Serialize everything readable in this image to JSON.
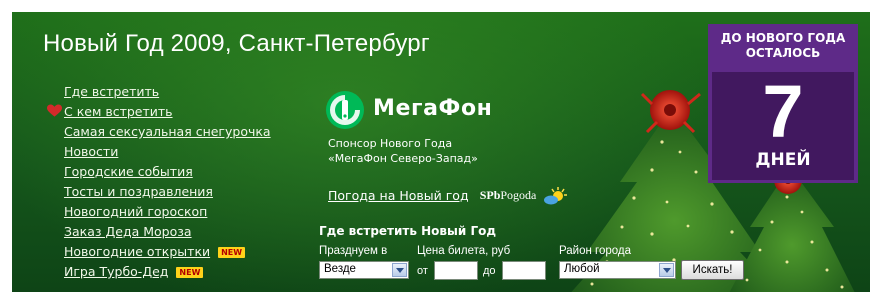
{
  "header": {
    "title": "Новый Год 2009, Санкт-Петербург"
  },
  "nav": {
    "items": [
      {
        "label": "Где встретить"
      },
      {
        "label": "С кем встретить",
        "icon": "heart-icon"
      },
      {
        "label": "Самая сексуальная снегурочка"
      },
      {
        "label": "Новости"
      },
      {
        "label": "Городские события"
      },
      {
        "label": "Тосты и поздравления"
      },
      {
        "label": "Новогодний гороскоп"
      },
      {
        "label": "Заказ Деда Мороза"
      },
      {
        "label": "Новогодние открытки",
        "badge": "NEW"
      },
      {
        "label": "Игра Турбо-Дед",
        "badge": "NEW"
      }
    ]
  },
  "sponsor": {
    "logo_text": "МегаФон",
    "line1": "Спонсор Нового Года",
    "line2": "«МегаФон Северо-Запад»"
  },
  "weather": {
    "link": "Погода на Новый год",
    "logo_bold": "SPb",
    "logo_rest": "Pogoda",
    "icon": "sun-cloud-icon"
  },
  "search": {
    "title": "Где встретить Новый Год",
    "celebrate_label": "Празднуем в",
    "celebrate_value": "Везде",
    "price_label": "Цена билета, руб",
    "from_label": "от",
    "to_label": "до",
    "from_value": "",
    "to_value": "",
    "district_label": "Район города",
    "district_value": "Любой",
    "button": "Искать!"
  },
  "countdown": {
    "line1": "ДО НОВОГО ГОДА",
    "line2": "ОСТАЛОСЬ",
    "number": "7",
    "unit": "ДНЕЙ"
  },
  "colors": {
    "background": "#15561b",
    "countdown_outer": "#5e2a88",
    "countdown_inner": "#41185f",
    "badge": "#ffd21a",
    "heart": "#d42a2a",
    "megafon_green": "#00b957"
  }
}
